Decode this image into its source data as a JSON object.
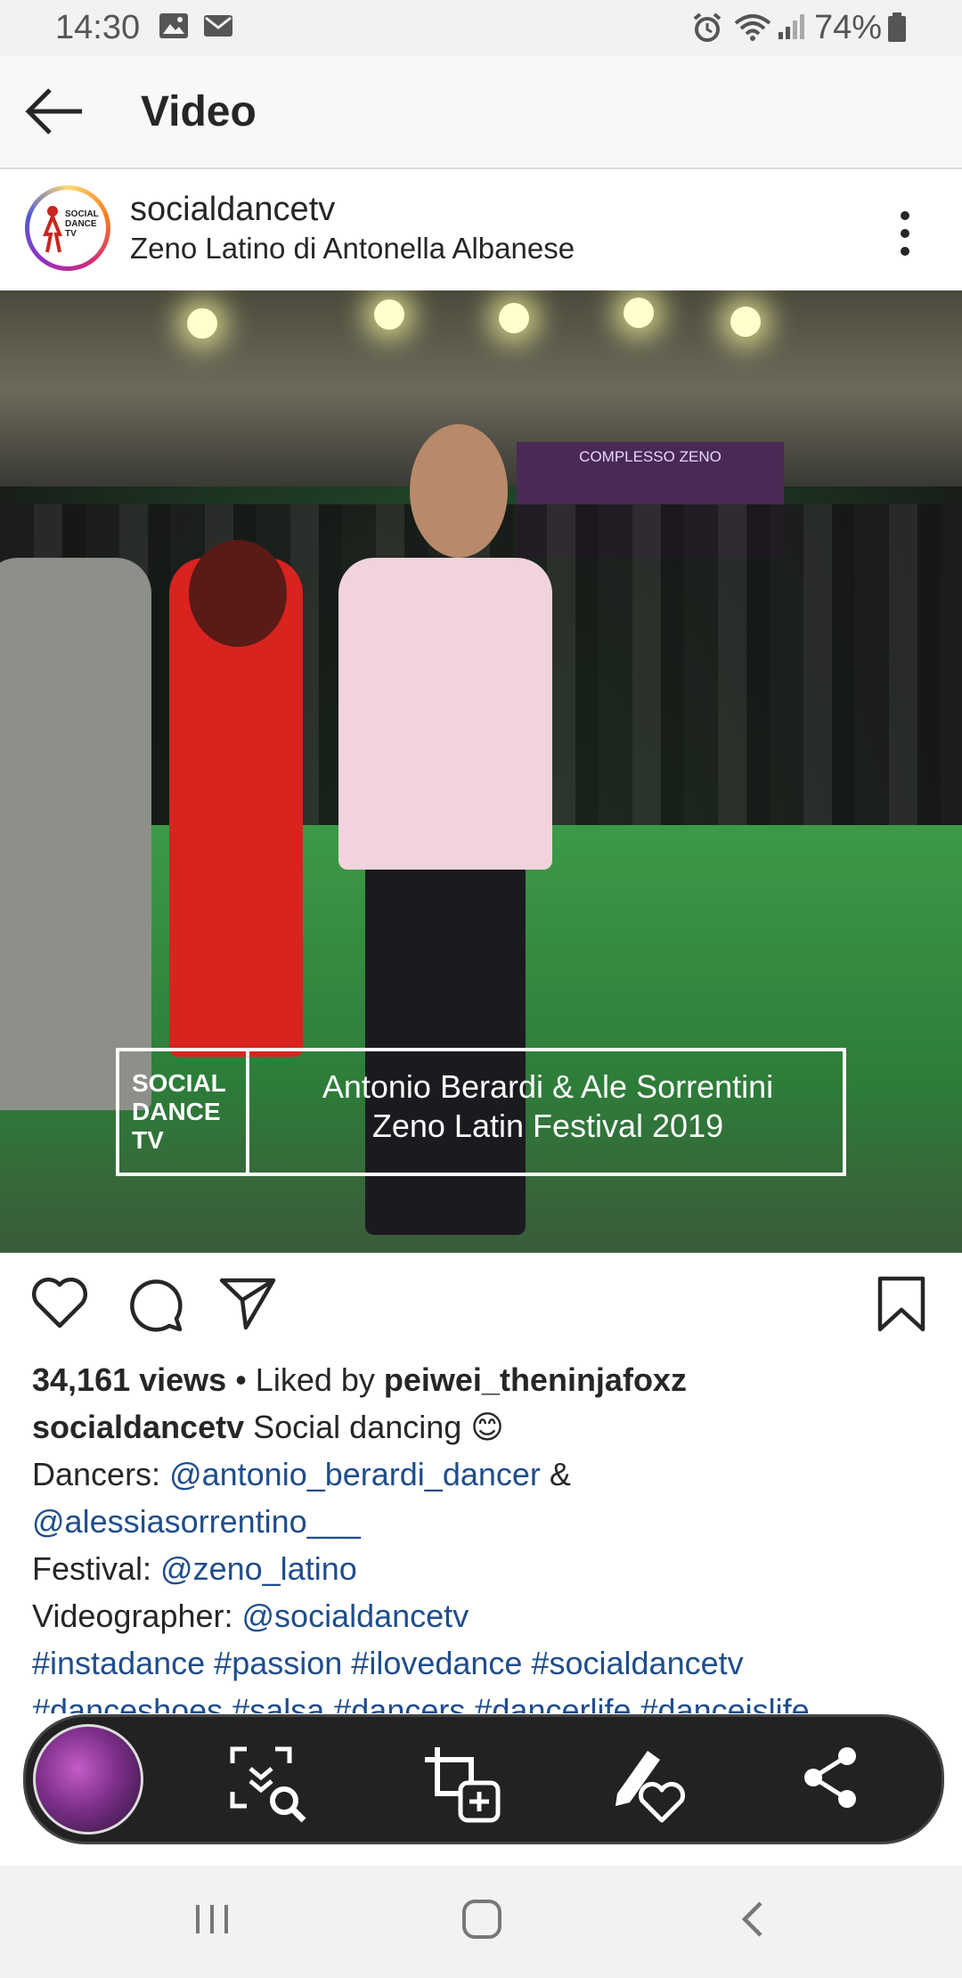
{
  "status_bar": {
    "time": "14:30",
    "battery": "74%",
    "icons": [
      "image-icon",
      "mail-icon",
      "alarm-icon",
      "wifi-icon",
      "signal-icon",
      "battery-icon"
    ]
  },
  "app_bar": {
    "title": "Video",
    "back_icon": "arrow-left-icon"
  },
  "post": {
    "username": "socialdancetv",
    "location": "Zeno Latino di Antonella Albanese",
    "avatar_text": [
      "SOCIAL",
      "DANCE",
      "TV"
    ],
    "video": {
      "banner_sign": "COMPLESSO ZENO",
      "overlay_brand": [
        "SOCIAL",
        "DANCE",
        "TV"
      ],
      "overlay_caption_line1": "Antonio Berardi & Ale Sorrentini",
      "overlay_caption_line2": "Zeno Latin Festival 2019"
    },
    "views": "34,161 views",
    "liked_by_prefix": " • Liked by ",
    "liked_by_user": "peiwei_theninjafoxz",
    "caption": {
      "username": "socialdancetv",
      "text": " Social dancing 😊",
      "dancers_label": "Dancers: ",
      "dancer1": "@antonio_berardi_dancer",
      "and": " &",
      "dancer2": "@alessiasorrentino___",
      "festival_label": "Festival: ",
      "festival": "@zeno_latino",
      "videographer_label": "Videographer: ",
      "videographer": "@socialdancetv",
      "hashtags_line1": [
        "#instadance",
        "#passion",
        "#ilovedance",
        "#socialdancetv"
      ],
      "hashtags_line2": [
        "#danceshoes",
        "#salsa",
        "#dancers",
        "#dancerlife",
        "#danceislife"
      ]
    }
  },
  "screenshot_toolbar": {
    "buttons": [
      "scroll-capture-icon",
      "crop-icon",
      "draw-icon",
      "share-icon"
    ]
  },
  "colors": {
    "link": "#1f4d8c",
    "text": "#262626",
    "toolbar_bg": "#222222"
  }
}
